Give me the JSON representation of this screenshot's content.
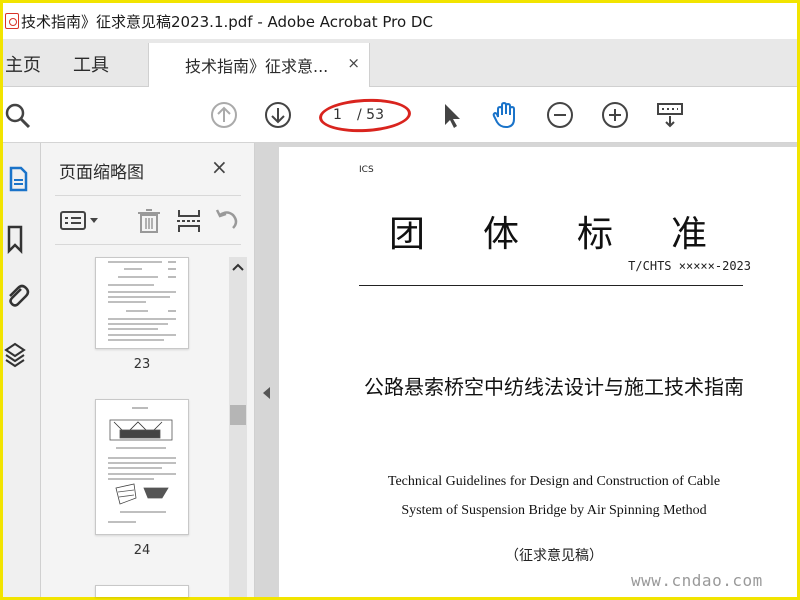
{
  "window": {
    "title": "技术指南》征求意见稿2023.1.pdf - Adobe Acrobat Pro DC"
  },
  "tabs": {
    "home": "主页",
    "tools": "工具",
    "document": "技术指南》征求意...",
    "close": "×"
  },
  "toolbar": {
    "icons": [
      "search-icon",
      "page-up-icon",
      "page-down-icon",
      "select-cursor-icon",
      "hand-tool-icon",
      "zoom-out-icon",
      "zoom-in-icon",
      "keyboard-icon"
    ],
    "current_page": "1",
    "total_pages": "/ 53",
    "hand_color": "#1a73c9"
  },
  "thumbnail_panel": {
    "title": "页面缩略图",
    "close": "×",
    "thumbnails": [
      {
        "label": "23"
      },
      {
        "label": "24"
      }
    ]
  },
  "document": {
    "ics": "ICS",
    "title": "团体标准",
    "standard_number": "T/CHTS ×××××-2023",
    "chinese_title": "公路悬索桥空中纺线法设计与施工技术指南",
    "english_title_line1": "Technical Guidelines for Design and Construction of Cable",
    "english_title_line2": "System of Suspension Bridge by Air Spinning Method",
    "draft_label": "（征求意见稿）"
  },
  "watermark": "www.cndao.com",
  "colors": {
    "border": "#f2e400",
    "annotation": "#d9241e",
    "acrobat_red": "#d8332a"
  }
}
